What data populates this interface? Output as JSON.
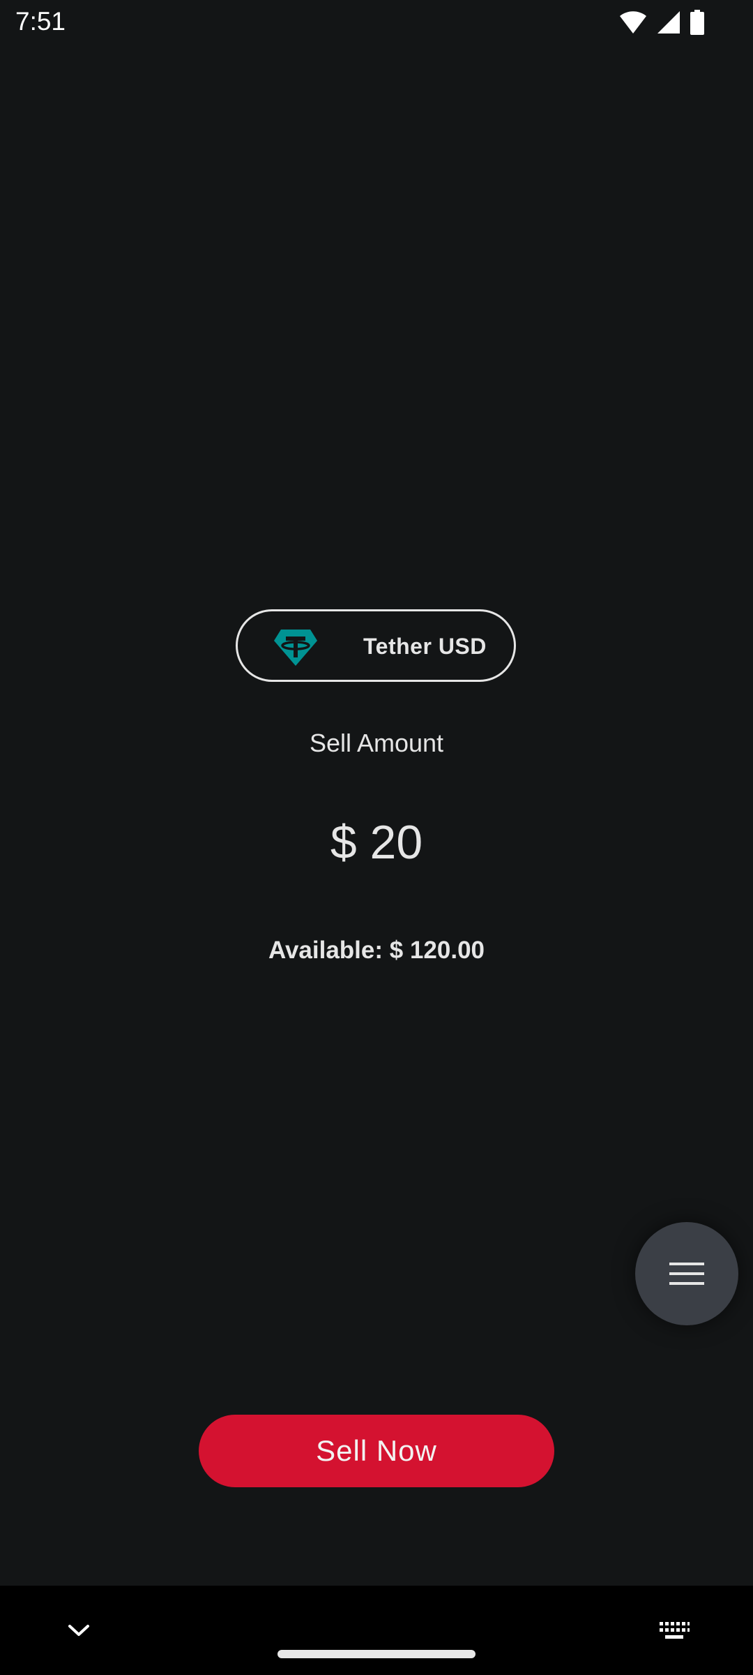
{
  "status_bar": {
    "time": "7:51",
    "icons": [
      "wifi-icon",
      "cellular-signal-icon",
      "battery-icon"
    ]
  },
  "token": {
    "name": "Tether USD",
    "icon": "tether-icon",
    "icon_color": "#009393"
  },
  "sell": {
    "label": "Sell Amount",
    "amount": "$ 20",
    "available": "Available: $ 120.00"
  },
  "fab": {
    "icon": "hamburger-menu-icon"
  },
  "actions": {
    "sell_now_label": "Sell Now",
    "sell_now_color": "#d41230"
  },
  "nav_bar": {
    "icons": [
      "chevron-down-icon",
      "keyboard-icon"
    ]
  }
}
